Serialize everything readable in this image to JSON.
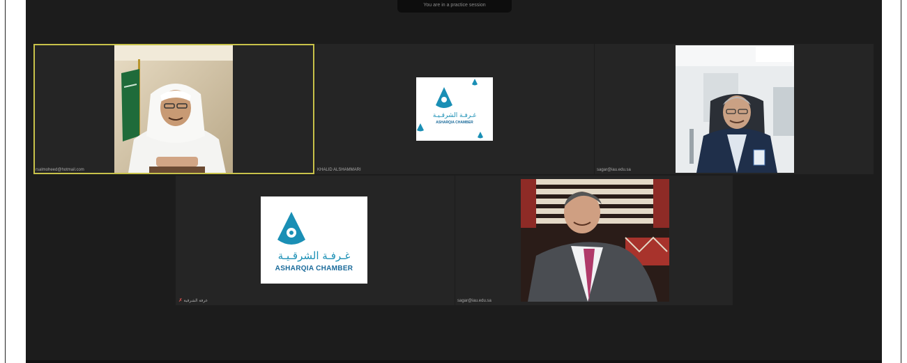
{
  "banner": "You are in a practice session",
  "tiles": [
    {
      "label": "rsalmoheed@hotmail.com"
    },
    {
      "label": "KHALID ALSHAMMARI"
    },
    {
      "label": "sagar@iau.edu.sa"
    },
    {
      "label": "غرفة الشرقية"
    },
    {
      "label": "sagar@iau.edu.sa"
    }
  ],
  "logo": {
    "arabic": "غـرفـة الشرقـيـة",
    "latin": "ASHARQIA CHAMBER"
  },
  "colors": {
    "active_border": "#c8c24a",
    "tile_bg": "#252525",
    "window_bg": "#1c1c1c",
    "logo_blue": "#1a8fb5"
  }
}
